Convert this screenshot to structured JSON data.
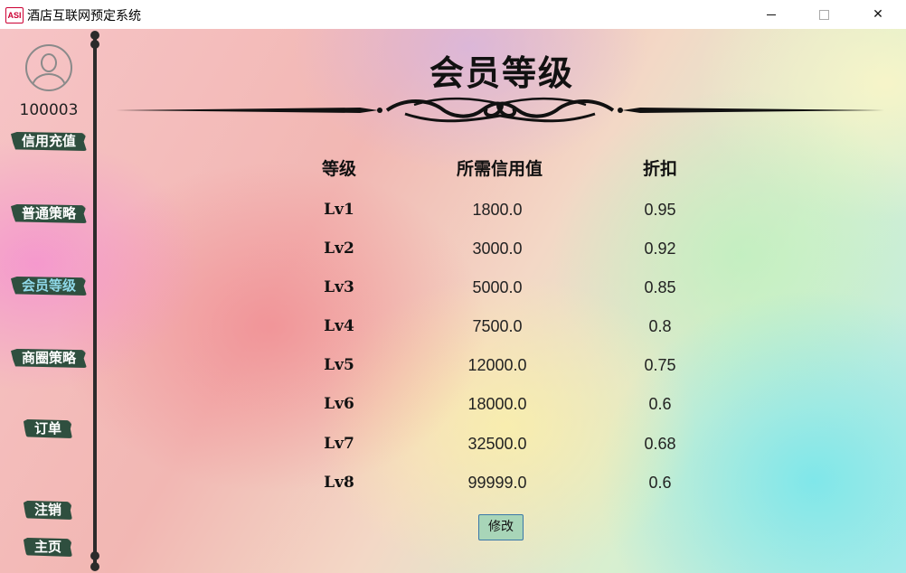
{
  "window": {
    "icon_label": "ASI",
    "title": "酒店互联网预定系统",
    "controls": [
      "minimize",
      "maximize",
      "close"
    ]
  },
  "sidebar": {
    "user_id": "100003",
    "avatar_icon": "user-avatar-icon",
    "items": [
      {
        "label": "信用充值",
        "active": false
      },
      {
        "label": "普通策略",
        "active": false
      },
      {
        "label": "会员等级",
        "active": true
      },
      {
        "label": "商圈策略",
        "active": false
      },
      {
        "label": "订单",
        "active": false
      },
      {
        "label": "注销",
        "active": false
      },
      {
        "label": "主页",
        "active": false
      }
    ],
    "button_color": "#2f4f3f",
    "active_text_color": "#8fd8e8"
  },
  "main": {
    "title": "会员等级",
    "table": {
      "headers": [
        "等级",
        "所需信用值",
        "折扣"
      ],
      "rows": [
        {
          "level": "Lv1",
          "credit": "1800.0",
          "discount": "0.95"
        },
        {
          "level": "Lv2",
          "credit": "3000.0",
          "discount": "0.92"
        },
        {
          "level": "Lv3",
          "credit": "5000.0",
          "discount": "0.85"
        },
        {
          "level": "Lv4",
          "credit": "7500.0",
          "discount": "0.8"
        },
        {
          "level": "Lv5",
          "credit": "12000.0",
          "discount": "0.75"
        },
        {
          "level": "Lv6",
          "credit": "18000.0",
          "discount": "0.6"
        },
        {
          "level": "Lv7",
          "credit": "32500.0",
          "discount": "0.68"
        },
        {
          "level": "Lv8",
          "credit": "99999.0",
          "discount": "0.6"
        }
      ]
    },
    "edit_button": "修改"
  }
}
